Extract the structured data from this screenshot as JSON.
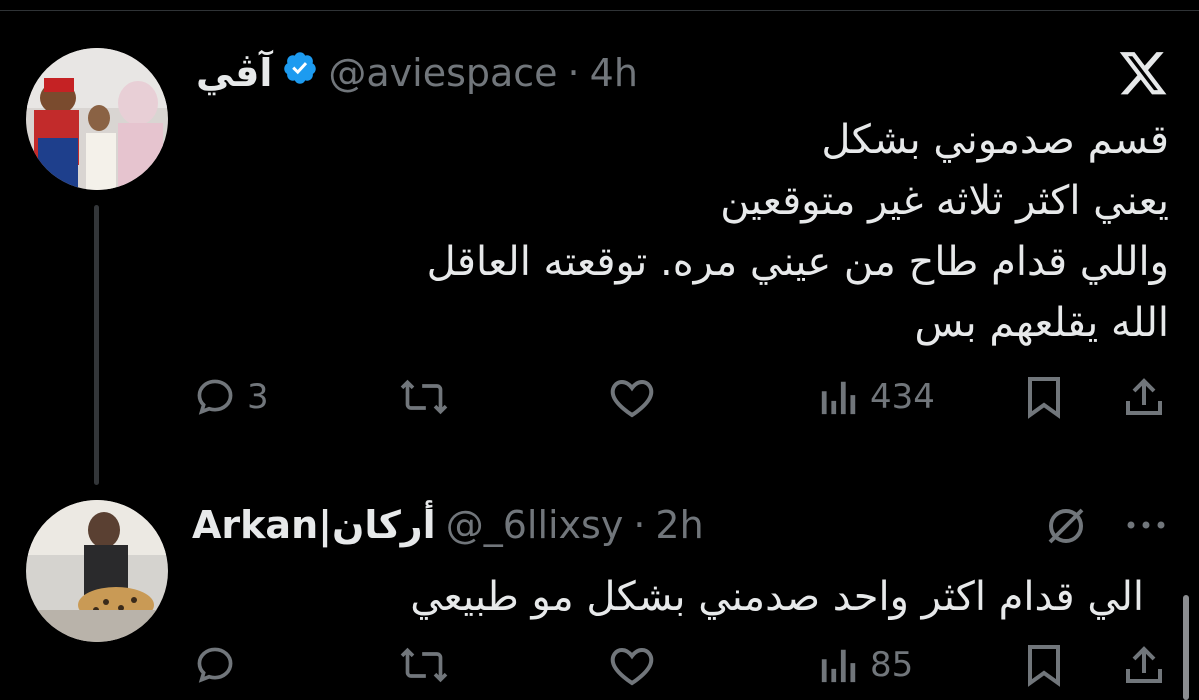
{
  "tweet1": {
    "name": "آڤي",
    "handle": "@aviespace",
    "time": "4h",
    "lines": [
      "قسم صدموني بشكل",
      "يعني اكثر ثلاثه غير متوقعين",
      "واللي قدام طاح من عيني مره. توقعته العاقل",
      "الله يقلعهم بس"
    ],
    "replies": "3",
    "views": "434"
  },
  "tweet2": {
    "name": "Arkan|أركان",
    "handle": "@_6llixsy",
    "time": "2h",
    "lines": [
      "الي قدام اكثر واحد صدمني بشكل مو طبيعي"
    ],
    "views": "85"
  },
  "icons": [
    "x-logo-icon",
    "verified-icon",
    "reply-icon",
    "retweet-icon",
    "like-icon",
    "views-icon",
    "bookmark-icon",
    "share-icon",
    "grok-icon",
    "more-icon"
  ],
  "colors": {
    "background": "#000000",
    "text": "#e7e9ea",
    "muted": "#71767b",
    "verified": "#1d9bf0"
  }
}
